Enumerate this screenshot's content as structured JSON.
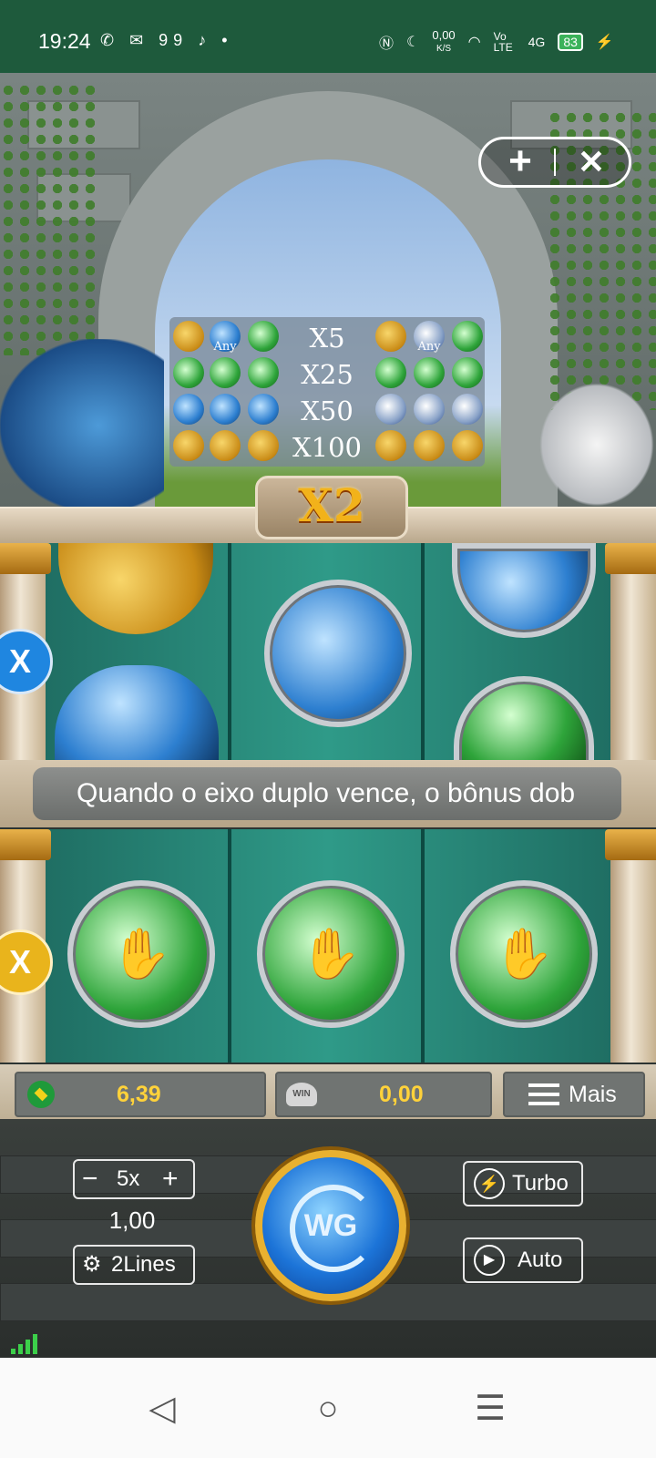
{
  "status_bar": {
    "time": "19:24",
    "notification_icons": "✆ ✉ 99 ♪ •",
    "net_speed": "0,00",
    "net_unit": "K/S",
    "volte": "Vo LTE",
    "network": "4G",
    "battery": "83"
  },
  "paytable": {
    "rows": [
      {
        "mult": "X5",
        "left_any": "Any",
        "right_any": "Any"
      },
      {
        "mult": "X25"
      },
      {
        "mult": "X50"
      },
      {
        "mult": "X100"
      }
    ]
  },
  "multiplier_badge": "X2",
  "side_button_top": "X",
  "side_button_bottom": "X",
  "message": "Quando o eixo duplo vence, o bônus dob",
  "info_bar": {
    "balance": "6,39",
    "win": "0,00",
    "win_icon_text": "WIN",
    "menu_label": "Mais"
  },
  "controls": {
    "multiplier": "5x",
    "bet": "1,00",
    "lines": "2Lines",
    "turbo": "Turbo",
    "auto": "Auto",
    "spin_logo": "WG"
  },
  "colors": {
    "status_bar": "#1e5a3c",
    "value_text": "#ffd23a",
    "badge_text": "#f2b21a"
  }
}
